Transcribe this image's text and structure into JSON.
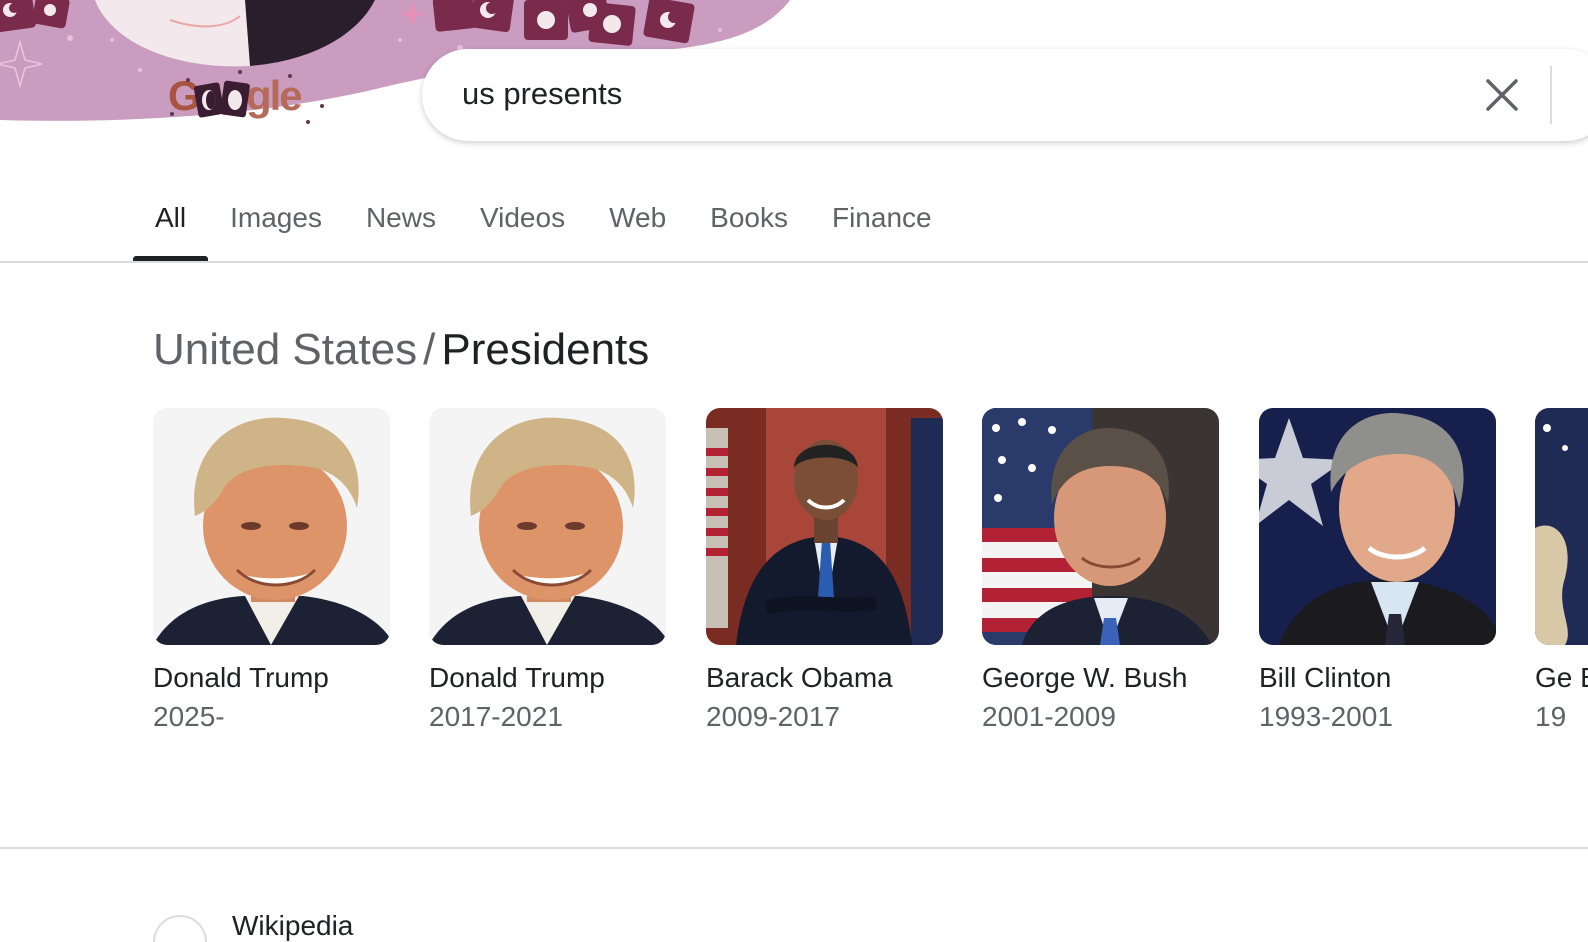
{
  "search": {
    "query": "us presents",
    "clear_icon": "close-icon"
  },
  "logo": {
    "text": "Google"
  },
  "tabs": [
    {
      "label": "All",
      "active": true
    },
    {
      "label": "Images",
      "active": false
    },
    {
      "label": "News",
      "active": false
    },
    {
      "label": "Videos",
      "active": false
    },
    {
      "label": "Web",
      "active": false
    },
    {
      "label": "Books",
      "active": false
    },
    {
      "label": "Finance",
      "active": false
    }
  ],
  "panel": {
    "parent": "United States",
    "separator": "/",
    "title": "Presidents",
    "people": [
      {
        "name": "Donald Trump",
        "years": "2025-"
      },
      {
        "name": "Donald Trump",
        "years": "2017-2021"
      },
      {
        "name": "Barack Obama",
        "years": "2009-2017"
      },
      {
        "name": "George W. Bush",
        "years": "2001-2009"
      },
      {
        "name": "Bill Clinton",
        "years": "1993-2001"
      },
      {
        "name": "Ge Bu",
        "years": "19"
      }
    ]
  },
  "result": {
    "source": "Wikipedia"
  },
  "colors": {
    "doodle_pink": "#c99cc0",
    "doodle_dark": "#7a2a4a",
    "active_tab": "#202124",
    "muted_text": "#5f6368"
  }
}
